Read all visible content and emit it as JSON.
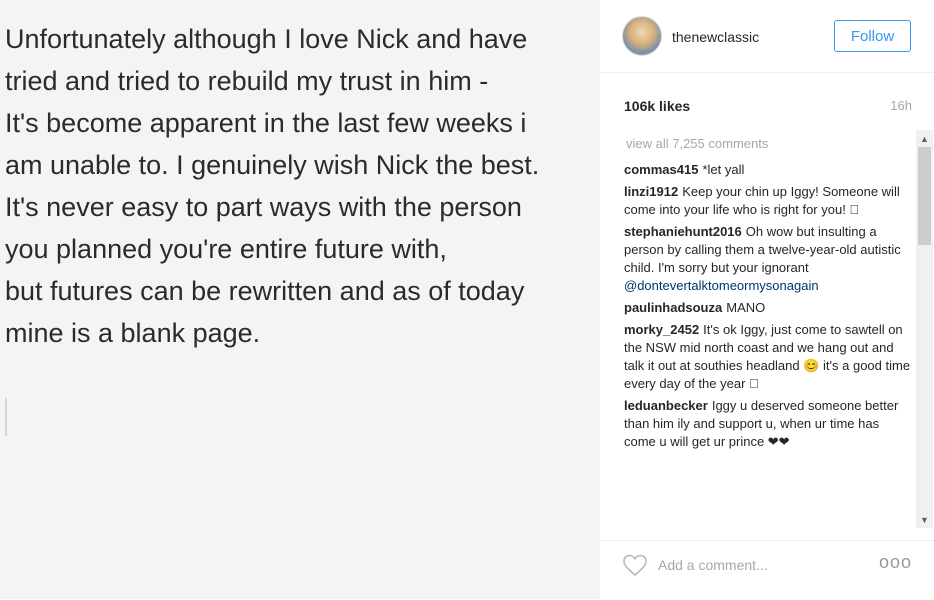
{
  "post": {
    "lines": [
      "Unfortunately although I love Nick and have",
      "tried and tried to rebuild my trust in him -",
      "It's become apparent in the last few weeks i",
      "am unable to. I genuinely wish Nick the best.",
      "It's never easy to part ways with the person",
      "you planned you're entire future with,",
      "but futures can be rewritten and as of today",
      "mine is a blank page."
    ]
  },
  "header": {
    "username": "thenewclassic",
    "follow_label": "Follow"
  },
  "stats": {
    "likes": "106k likes",
    "time": "16h",
    "view_all": "view all 7,255 comments"
  },
  "comments": [
    {
      "user": "commas415",
      "text": "*let yall"
    },
    {
      "user": "linzi1912",
      "text": "Keep your chin up Iggy! Someone will come into your life who is right for you! 🏼"
    },
    {
      "user": "stephaniehunt2016",
      "text": "Oh wow but insulting a person by calling them a twelve-year-old autistic child. I'm sorry but your ignorant",
      "mention": "@dontevertalktomeormysonagain"
    },
    {
      "user": "paulinhadsouza",
      "text": "MANO"
    },
    {
      "user": "morky_2452",
      "text": "It's ok Iggy, just come to sawtell on the NSW mid north coast and we hang out and talk it out at southies headland 😊 it's a good time every day of the year 🏼"
    },
    {
      "user": "leduanbecker",
      "text": "Iggy u deserved someone better than him ily and support u, when ur time has come u will get ur prince ❤❤"
    }
  ],
  "footer": {
    "comment_placeholder": "Add a comment...",
    "more_label": "ooo"
  },
  "icons": {
    "heart": "heart-icon",
    "more": "more-options-icon",
    "scroll_up": "scroll-up-arrow",
    "scroll_down": "scroll-down-arrow"
  },
  "colors": {
    "accent": "#3897f0",
    "mention": "#003569",
    "muted": "#a5a7aa"
  }
}
